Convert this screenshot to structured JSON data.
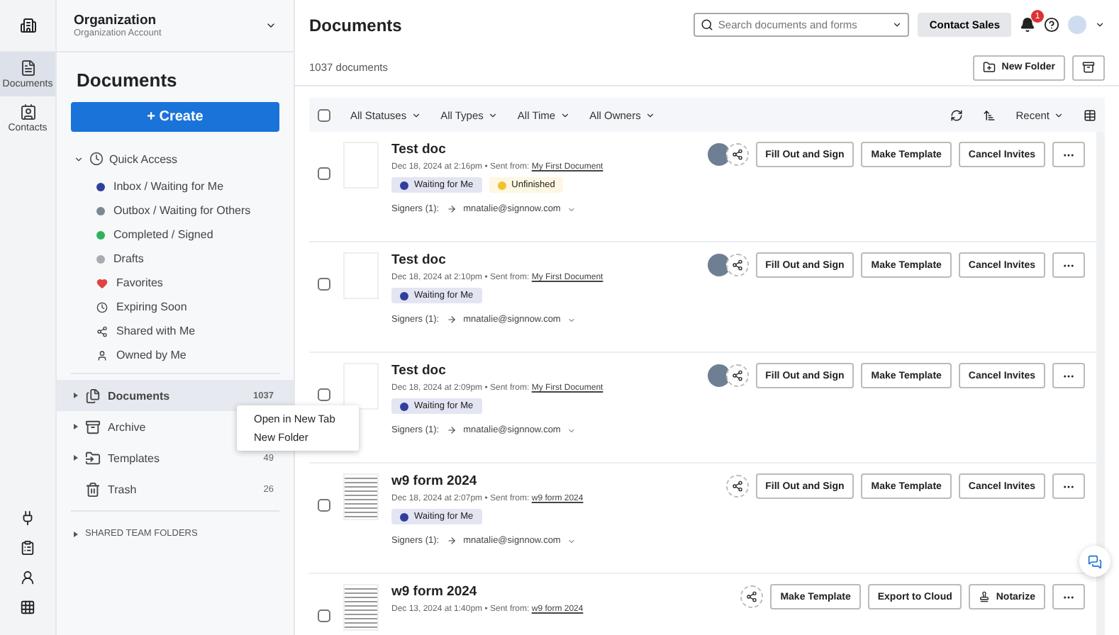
{
  "org": {
    "name": "Organization",
    "account": "Organization Account"
  },
  "rail": [
    {
      "label": "Documents",
      "kind": "docs",
      "selected": true
    },
    {
      "label": "Contacts",
      "kind": "contacts",
      "selected": false
    }
  ],
  "sidebar": {
    "title": "Documents",
    "create_button": "+ Create",
    "quick_access": {
      "label": "Quick Access",
      "expanded": true,
      "items": [
        {
          "label": "Inbox / Waiting for Me",
          "kind": "dot",
          "color": "#2f3f9e"
        },
        {
          "label": "Outbox / Waiting for Others",
          "kind": "dot",
          "color": "#7b8794"
        },
        {
          "label": "Completed / Signed",
          "kind": "dot",
          "color": "#2fb35a"
        },
        {
          "label": "Drafts",
          "kind": "dot",
          "color": "#a8acb3"
        },
        {
          "label": "Favorites",
          "kind": "heart"
        },
        {
          "label": "Expiring Soon",
          "kind": "clock"
        },
        {
          "label": "Shared with Me",
          "kind": "share"
        },
        {
          "label": "Owned by Me",
          "kind": "person"
        }
      ]
    },
    "folders": [
      {
        "label": "Documents",
        "count": "1037",
        "kind": "documents",
        "selected": true
      },
      {
        "label": "Archive",
        "kind": "archive",
        "selected": false
      },
      {
        "label": "Templates",
        "count": "49",
        "kind": "templates",
        "selected": false
      },
      {
        "label": "Trash",
        "count": "26",
        "kind": "trash",
        "selected": false
      }
    ],
    "shared_team_folders": "SHARED TEAM FOLDERS"
  },
  "context_menu": [
    "Open in New Tab",
    "New Folder"
  ],
  "header": {
    "title": "Documents",
    "search_placeholder": "Search documents and forms",
    "contact_sales": "Contact Sales",
    "notifications": "1"
  },
  "subheader": {
    "count": "1037 documents",
    "new_folder": "New Folder"
  },
  "select_all_checked": false,
  "filters": [
    "All Statuses",
    "All Types",
    "All Time",
    "All Owners"
  ],
  "sort": "Recent",
  "documents": [
    {
      "title": "Test doc",
      "date": "Dec 18, 2024 at 2:16pm",
      "separator": "•",
      "sent_label": "Sent from:",
      "sent_from": "My First Document",
      "kind": "blank",
      "avatar": true,
      "checked": false,
      "statuses": [
        {
          "label": "Waiting for Me",
          "color": "#2f3f9e"
        },
        {
          "label": "Unfinished",
          "color": "#f2c12e"
        }
      ],
      "signers_label": "Signers (1):",
      "signer": "mnatalie@signnow.com",
      "actions": [
        "Fill Out and Sign",
        "Make Template",
        "Cancel Invites"
      ]
    },
    {
      "title": "Test doc",
      "date": "Dec 18, 2024 at 2:10pm",
      "separator": "•",
      "sent_label": "Sent from:",
      "sent_from": "My First Document",
      "kind": "blank",
      "avatar": true,
      "checked": false,
      "statuses": [
        {
          "label": "Waiting for Me",
          "color": "#2f3f9e"
        }
      ],
      "signers_label": "Signers (1):",
      "signer": "mnatalie@signnow.com",
      "actions": [
        "Fill Out and Sign",
        "Make Template",
        "Cancel Invites"
      ]
    },
    {
      "title": "Test doc",
      "date": "Dec 18, 2024 at 2:09pm",
      "separator": "•",
      "sent_label": "Sent from:",
      "sent_from": "My First Document",
      "kind": "blank",
      "avatar": true,
      "checked": false,
      "statuses": [
        {
          "label": "Waiting for Me",
          "color": "#2f3f9e"
        }
      ],
      "signers_label": "Signers (1):",
      "signer": "mnatalie@signnow.com",
      "actions": [
        "Fill Out and Sign",
        "Make Template",
        "Cancel Invites"
      ]
    },
    {
      "title": "w9 form 2024",
      "date": "Dec 18, 2024 at 2:07pm",
      "separator": "•",
      "sent_label": "Sent from:",
      "sent_from": "w9 form 2024",
      "kind": "form",
      "avatar": false,
      "checked": false,
      "statuses": [
        {
          "label": "Waiting for Me",
          "color": "#2f3f9e"
        }
      ],
      "signers_label": "Signers (1):",
      "signer": "mnatalie@signnow.com",
      "actions": [
        "Fill Out and Sign",
        "Make Template",
        "Cancel Invites"
      ]
    },
    {
      "title": "w9 form 2024",
      "date": "Dec 13, 2024 at 1:40pm",
      "separator": "•",
      "sent_label": "Sent from:",
      "sent_from": "w9 form 2024",
      "kind": "form",
      "avatar": false,
      "checked": false,
      "actions": [
        "Make Template",
        "Export to Cloud",
        "Notarize"
      ]
    }
  ]
}
